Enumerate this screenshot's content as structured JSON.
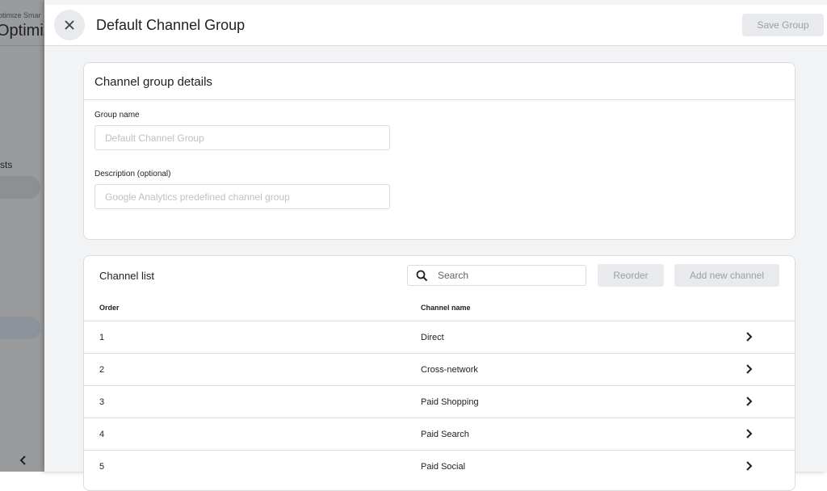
{
  "background_app": {
    "subtitle": "ptimize Smar",
    "title": "Optimiz",
    "nav_text": "sts"
  },
  "header": {
    "title": "Default Channel Group",
    "save_label": "Save Group"
  },
  "details": {
    "section_title": "Channel group details",
    "group_name_label": "Group name",
    "group_name_placeholder": "Default Channel Group",
    "description_label": "Description (optional)",
    "description_placeholder": "Google Analytics predefined channel group"
  },
  "channel_list": {
    "title": "Channel list",
    "search_placeholder": "Search",
    "reorder_label": "Reorder",
    "add_label": "Add new channel",
    "columns": {
      "order": "Order",
      "name": "Channel name"
    },
    "rows": [
      {
        "order": "1",
        "name": "Direct"
      },
      {
        "order": "2",
        "name": "Cross-network"
      },
      {
        "order": "3",
        "name": "Paid Shopping"
      },
      {
        "order": "4",
        "name": "Paid Search"
      },
      {
        "order": "5",
        "name": "Paid Social"
      }
    ]
  },
  "icons": {
    "close": "close-icon",
    "search": "search-icon",
    "row_chevron": "chevron-right-icon",
    "collapse": "chevron-left-icon"
  },
  "colors": {
    "disabled_button_bg": "#e8eaed",
    "disabled_button_text": "#9aa0a6",
    "panel_bg": "#f1f3f4",
    "divider": "#dadce0"
  }
}
